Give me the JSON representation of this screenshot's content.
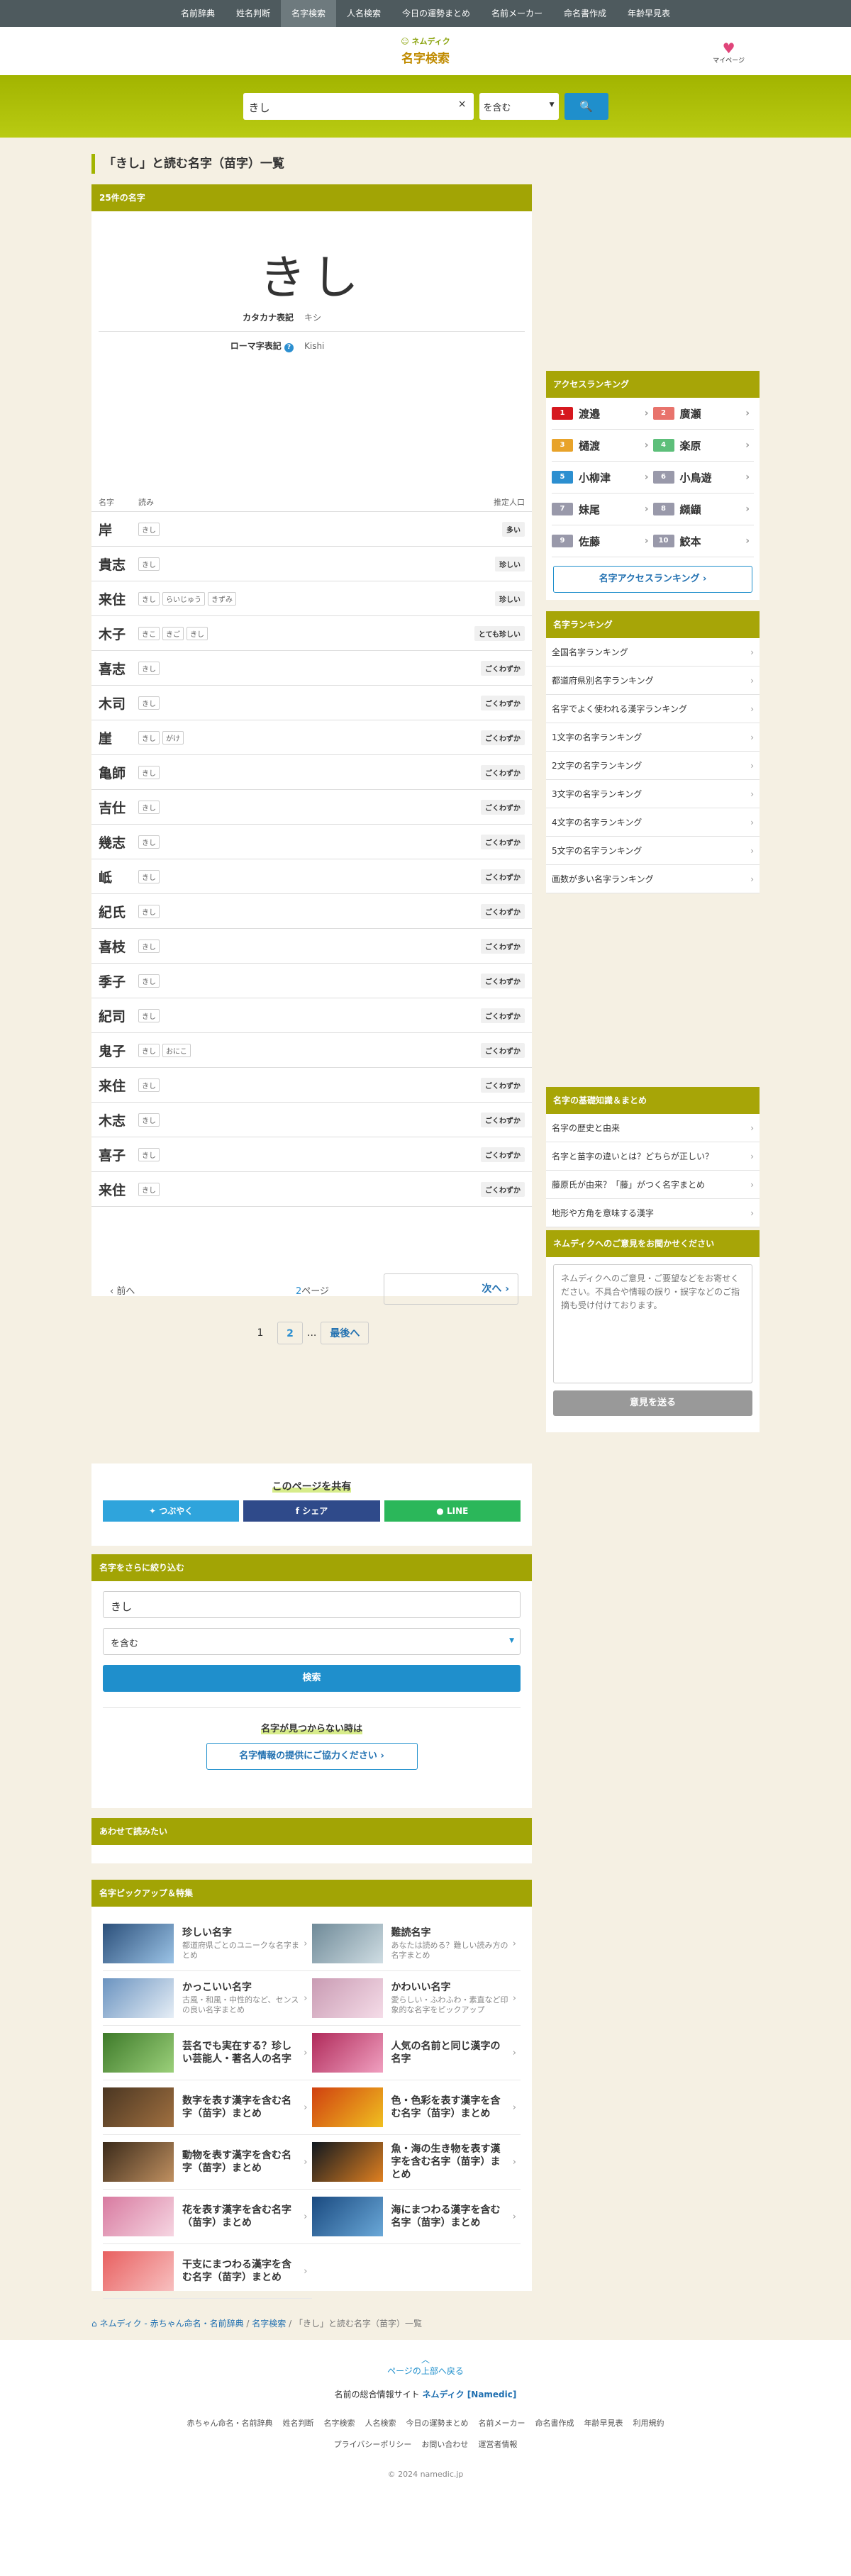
{
  "topnav": [
    "名前辞典",
    "姓名判断",
    "名字検索",
    "人名検索",
    "今日の運勢まとめ",
    "名前メーカー",
    "命名書作成",
    "年齢早見表"
  ],
  "header": {
    "logo_small": "ネムディク",
    "logo_big": "名字検索",
    "mypage": "マイページ"
  },
  "search": {
    "value": "きし",
    "clear": "×",
    "mode": "を含む",
    "button": "🔍"
  },
  "title": "「きし」と読む名字（苗字）一覧",
  "result_bar": "25件の名字",
  "detail": {
    "name": "きし",
    "katakana_label": "カタカナ表記",
    "katakana": "キシ",
    "roman_label": "ローマ字表記",
    "roman": "Kishi",
    "help": "?"
  },
  "table": {
    "col_name": "名字",
    "col_reading": "読み",
    "col_level": "推定人口"
  },
  "rows": [
    {
      "name": "岸",
      "readings": [
        "きし"
      ],
      "level": "多い"
    },
    {
      "name": "貴志",
      "readings": [
        "きし"
      ],
      "level": "珍しい"
    },
    {
      "name": "来住",
      "readings": [
        "きし",
        "らいじゅう",
        "きずみ"
      ],
      "level": "珍しい"
    },
    {
      "name": "木子",
      "readings": [
        "きこ",
        "きご",
        "きし"
      ],
      "level": "とても珍しい"
    },
    {
      "name": "喜志",
      "readings": [
        "きし"
      ],
      "level": "ごくわずか"
    },
    {
      "name": "木司",
      "readings": [
        "きし"
      ],
      "level": "ごくわずか"
    },
    {
      "name": "崖",
      "readings": [
        "きし",
        "がけ"
      ],
      "level": "ごくわずか"
    },
    {
      "name": "亀師",
      "readings": [
        "きし"
      ],
      "level": "ごくわずか"
    },
    {
      "name": "吉仕",
      "readings": [
        "きし"
      ],
      "level": "ごくわずか"
    },
    {
      "name": "幾志",
      "readings": [
        "きし"
      ],
      "level": "ごくわずか"
    },
    {
      "name": "岻",
      "readings": [
        "きし"
      ],
      "level": "ごくわずか"
    },
    {
      "name": "紀氏",
      "readings": [
        "きし"
      ],
      "level": "ごくわずか"
    },
    {
      "name": "喜枝",
      "readings": [
        "きし"
      ],
      "level": "ごくわずか"
    },
    {
      "name": "季子",
      "readings": [
        "きし"
      ],
      "level": "ごくわずか"
    },
    {
      "name": "紀司",
      "readings": [
        "きし"
      ],
      "level": "ごくわずか"
    },
    {
      "name": "鬼子",
      "readings": [
        "きし",
        "おにこ"
      ],
      "level": "ごくわずか"
    },
    {
      "name": "来住",
      "readings": [
        "きし"
      ],
      "level": "ごくわずか"
    },
    {
      "name": "木志",
      "readings": [
        "きし"
      ],
      "level": "ごくわずか"
    },
    {
      "name": "喜子",
      "readings": [
        "きし"
      ],
      "level": "ごくわずか"
    },
    {
      "name": "来住",
      "readings": [
        "きし"
      ],
      "level": "ごくわずか"
    }
  ],
  "pager": {
    "prev": "前へ",
    "current": "2",
    "info_suffix": "ページ",
    "next": "次へ",
    "p1": "1",
    "p2": "2",
    "ellipsis": "...",
    "last": "最後へ"
  },
  "access_ranking": {
    "title": "アクセスランキング",
    "items": [
      {
        "n": "1",
        "name": "渡邉",
        "color": "#d6181f"
      },
      {
        "n": "2",
        "name": "廣瀬",
        "color": "#e8736c"
      },
      {
        "n": "3",
        "name": "樋渡",
        "color": "#e8a32a"
      },
      {
        "n": "4",
        "name": "楽原",
        "color": "#5dbf7a"
      },
      {
        "n": "5",
        "name": "小柳津",
        "color": "#2c8fd0"
      },
      {
        "n": "6",
        "name": "小鳥遊",
        "color": "#99a"
      },
      {
        "n": "7",
        "name": "妹尾",
        "color": "#99a"
      },
      {
        "n": "8",
        "name": "纐纈",
        "color": "#99a"
      },
      {
        "n": "9",
        "name": "佐藤",
        "color": "#99a"
      },
      {
        "n": "10",
        "name": "鮫本",
        "color": "#99a"
      }
    ],
    "button": "名字アクセスランキング"
  },
  "name_ranking": {
    "title": "名字ランキング",
    "items": [
      "全国名字ランキング",
      "都道府県別名字ランキング",
      "名字でよく使われる漢字ランキング",
      "1文字の名字ランキング",
      "2文字の名字ランキング",
      "3文字の名字ランキング",
      "4文字の名字ランキング",
      "5文字の名字ランキング",
      "画数が多い名字ランキング"
    ]
  },
  "basics": {
    "title": "名字の基礎知識＆まとめ",
    "items": [
      "名字の歴史と由来",
      "名字と苗字の違いとは？どちらが正しい？",
      "藤原氏が由来？「藤」がつく名字まとめ",
      "地形や方角を意味する漢字"
    ]
  },
  "opinion": {
    "title": "ネムディクへのご意見をお聞かせください",
    "placeholder": "ネムディクへのご意見・ご要望などをお寄せください。不具合や情報の誤り・誤字などのご指摘も受け付けております。",
    "button": "意見を送る"
  },
  "share": {
    "title": "このページを共有",
    "tweet": "つぶやく",
    "facebook": "シェア",
    "line": "LINE"
  },
  "refine": {
    "title": "名字をさらに絞り込む",
    "value": "きし",
    "mode": "を含む",
    "button": "検索",
    "notfound": "名字が見つからない時は",
    "coop": "名字情報の提供にご協力ください"
  },
  "related": {
    "title": "あわせて読みたい"
  },
  "pickup": {
    "title": "名字ピックアップ＆特集",
    "items": [
      {
        "t": "珍しい名字",
        "d": "都道府県ごとのユニークな名字まとめ",
        "c1": "#2b4f7a",
        "c2": "#9bc3e6"
      },
      {
        "t": "難読名字",
        "d": "あなたは読める？難しい読み方の名字まとめ",
        "c1": "#6f8a98",
        "c2": "#cfdde3"
      },
      {
        "t": "かっこいい名字",
        "d": "古風・和風・中性的など、センスの良い名字まとめ",
        "c1": "#6a93c0",
        "c2": "#e6eef6"
      },
      {
        "t": "かわいい名字",
        "d": "愛らしい・ふわふわ・素直など印象的な名字をピックアップ",
        "c1": "#c99bb3",
        "c2": "#f5dce8"
      },
      {
        "t": "芸名でも実在する？珍しい芸能人・著名人の名字",
        "d": "",
        "c1": "#3e7a2a",
        "c2": "#9bd07a"
      },
      {
        "t": "人気の名前と同じ漢字の名字",
        "d": "",
        "c1": "#b02a5a",
        "c2": "#f0a0c0"
      },
      {
        "t": "数字を表す漢字を含む名字（苗字）まとめ",
        "d": "",
        "c1": "#4a3622",
        "c2": "#a07040"
      },
      {
        "t": "色・色彩を表す漢字を含む名字（苗字）まとめ",
        "d": "",
        "c1": "#d04010",
        "c2": "#f0c020"
      },
      {
        "t": "動物を表す漢字を含む名字（苗字）まとめ",
        "d": "",
        "c1": "#3a2a1a",
        "c2": "#c09060"
      },
      {
        "t": "魚・海の生き物を表す漢字を含む名字（苗字）まとめ",
        "d": "",
        "c1": "#101820",
        "c2": "#e08020"
      },
      {
        "t": "花を表す漢字を含む名字（苗字）まとめ",
        "d": "",
        "c1": "#d87aa0",
        "c2": "#f6d6e2"
      },
      {
        "t": "海にまつわる漢字を含む名字（苗字）まとめ",
        "d": "",
        "c1": "#1a4a80",
        "c2": "#6aa8d8"
      },
      {
        "t": "干支にまつわる漢字を含む名字（苗字）まとめ",
        "d": "",
        "c1": "#e86060",
        "c2": "#f8c0c0"
      }
    ]
  },
  "breadcrumb": {
    "home": "ネムディク - 赤ちゃん命名・名前辞典",
    "sep": "/",
    "mid": "名字検索",
    "current": "「きし」と読む名字（苗字）一覧"
  },
  "footer": {
    "totop": "ページの上部へ戻る",
    "site_prefix": "名前の総合情報サイト",
    "site_name": "ネムディク [Namedic]",
    "links": [
      "赤ちゃん命名・名前辞典",
      "姓名判断",
      "名字検索",
      "人名検索",
      "今日の運勢まとめ",
      "名前メーカー",
      "命名書作成",
      "年齢早見表",
      "利用規約",
      "プライバシーポリシー",
      "お問い合わせ",
      "運営者情報"
    ],
    "copyright": "© 2024 namedic.jp"
  }
}
